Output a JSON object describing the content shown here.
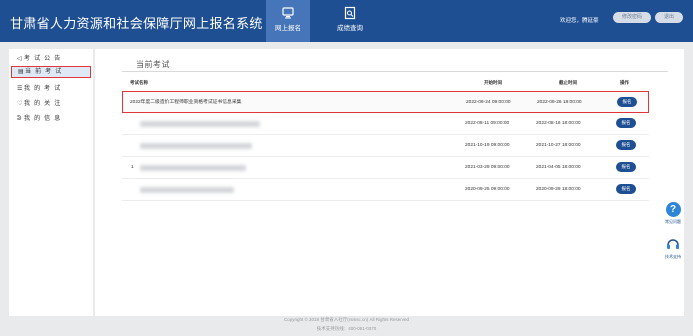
{
  "header": {
    "site_title": "甘肃省人力资源和社会保障厅网上报名系统",
    "nav": [
      {
        "label": "网上报名",
        "icon": "monitor-icon"
      },
      {
        "label": "成绩查询",
        "icon": "search-document-icon"
      }
    ],
    "welcome_text": "欢迎您，腾延豪",
    "btn_change_password": "修改密码",
    "btn_logout": "退出"
  },
  "sidebar": {
    "items": [
      {
        "label": "考 试 公 告",
        "icon": "announcement-icon",
        "active": false
      },
      {
        "label": "当 前 考 试",
        "icon": "document-icon",
        "active": true
      },
      {
        "label": "我 的 考 试",
        "icon": "list-icon",
        "active": false
      },
      {
        "label": "我 的 关 注",
        "icon": "heart-icon",
        "active": false
      },
      {
        "label": "我 的 信 息",
        "icon": "user-icon",
        "active": false
      }
    ]
  },
  "main": {
    "section_title": "当前考试",
    "columns": [
      "考试名称",
      "开始时间",
      "截止时间",
      "操作"
    ],
    "rows": [
      {
        "name": "2022年度二级造价工程师职业资格考试证书信息采集",
        "start": "2022-09-24 09:00:00",
        "end": "2022-09-26 18:00:00",
        "action": "报名"
      },
      {
        "name": "",
        "start": "2022-08-11 09:00:00",
        "end": "2022-08-16 18:00:00",
        "action": "报名"
      },
      {
        "name": "",
        "start": "2021-10-19 09:00:00",
        "end": "2021-10-27 18:00:00",
        "action": "报名"
      },
      {
        "name": "1",
        "start": "2021-03-29 09:00:00",
        "end": "2021-04-05 18:00:00",
        "action": "报名"
      },
      {
        "name": "",
        "start": "2020-09-25 09:00:00",
        "end": "2020-09-29 18:00:00",
        "action": "报名"
      }
    ]
  },
  "floating": {
    "faq_label": "常见问题",
    "support_label": "技术支持"
  },
  "footer": {
    "copyright": "Copyright © 2018 甘肃省人社厅(rsmsc.cn) All Rights Reserved",
    "hotline": "技术支持热线：400-051-0370"
  },
  "colors": {
    "header_bg": "#1f4f93",
    "accent": "#1f4f93",
    "highlight_border": "#e0353b"
  }
}
